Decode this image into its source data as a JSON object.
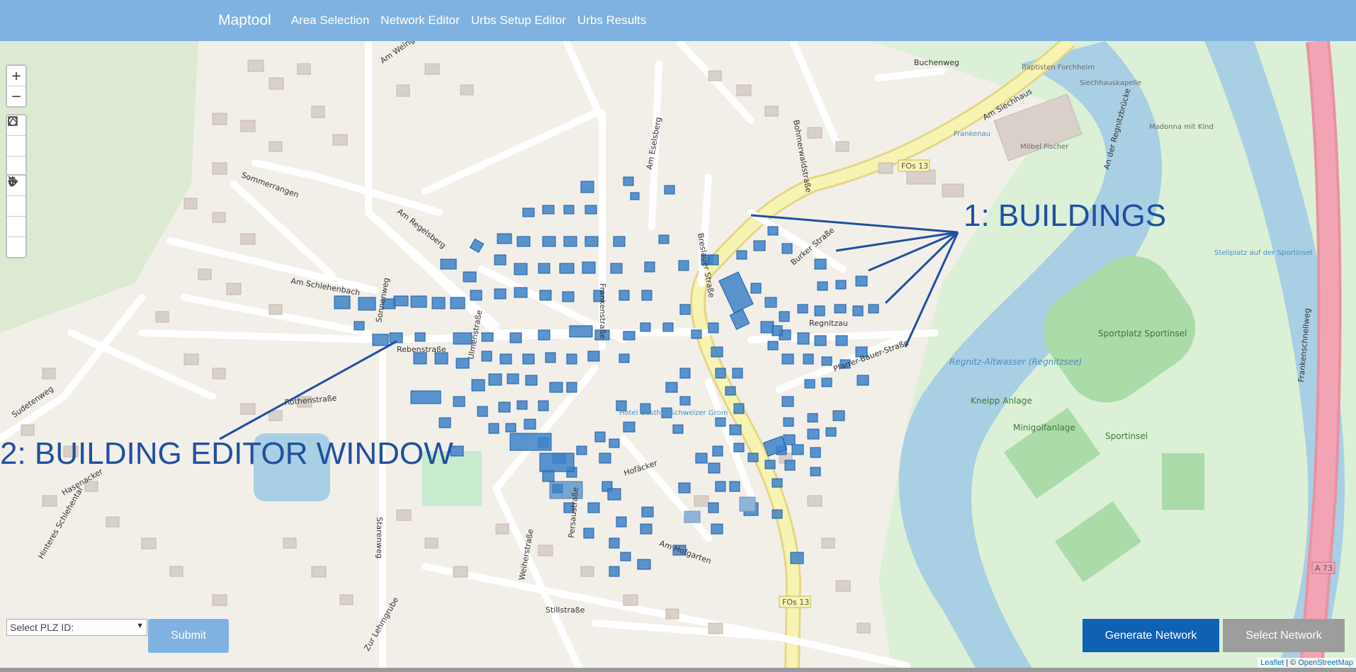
{
  "navbar": {
    "brand": "Maptool",
    "links": [
      "Area Selection",
      "Network Editor",
      "Urbs Setup Editor",
      "Urbs Results"
    ]
  },
  "map_controls": {
    "zoom": [
      "zoom-in-icon",
      "zoom-out-icon"
    ],
    "draw": [
      "rectangle-icon",
      "polyline-icon",
      "circle-icon"
    ],
    "edit": [
      "select-icon",
      "move-icon",
      "erase-icon",
      "rotate-icon"
    ]
  },
  "annotations": {
    "buildings": "1: BUILDINGS",
    "editor": "2: BUILDING EDITOR WINDOW"
  },
  "map_labels": {
    "streets": [
      "Am Weingartsteig",
      "Sommerrangen",
      "Am Regelsberg",
      "Am Schlehenbach",
      "Rebenstraße",
      "Rothenstraße",
      "Sudetenweg",
      "Hasenacker",
      "Frankenstraße",
      "Breslauer Straße",
      "Burker Straße",
      "Regnitzau",
      "Pfarrer-Bauer-Straße",
      "Hofäcker",
      "Am Hofgarten",
      "Stillstraße",
      "Am Siechhaus",
      "Buchenweg",
      "Bohmerwaldstraße",
      "Am Eselsberg",
      "Persaustraße",
      "Weiherstraße",
      "Ulmenstraße",
      "Sonnenweg",
      "An der Regnitzbrücke",
      "Frankenschnellweg",
      "Zur Lehmgrube",
      "Hinteres Schlehental",
      "Starenweg"
    ],
    "places": [
      "Regnitz-Altwasser (Regnitzsee)",
      "Sportinsel",
      "Sportplatz Sportinsel",
      "Minigolfanlage",
      "Kneipp Anlage",
      "Möbel Fischer",
      "Baptisten Forchheim",
      "Siechhauskapelle",
      "Frankenau",
      "Hotel Gasthof Schweizer Grom",
      "Madonna mit Kind",
      "Stellplatz auf der Sportinsel"
    ],
    "road_refs": [
      "FOs 13",
      "FOs 13",
      "A 73"
    ]
  },
  "form": {
    "plz_placeholder": "Select PLZ ID:",
    "submit": "Submit"
  },
  "actions": {
    "generate": "Generate Network",
    "select": "Select Network"
  },
  "attribution": {
    "leaflet": "Leaflet",
    "sep": " | © ",
    "osm": "OpenStreetMap"
  },
  "colors": {
    "navbar": "#7fb2e0",
    "building_highlight": "#3e82c8",
    "annotation": "#1f4fa0",
    "generate_button": "#1060b3",
    "select_button": "#9d9d9d"
  }
}
